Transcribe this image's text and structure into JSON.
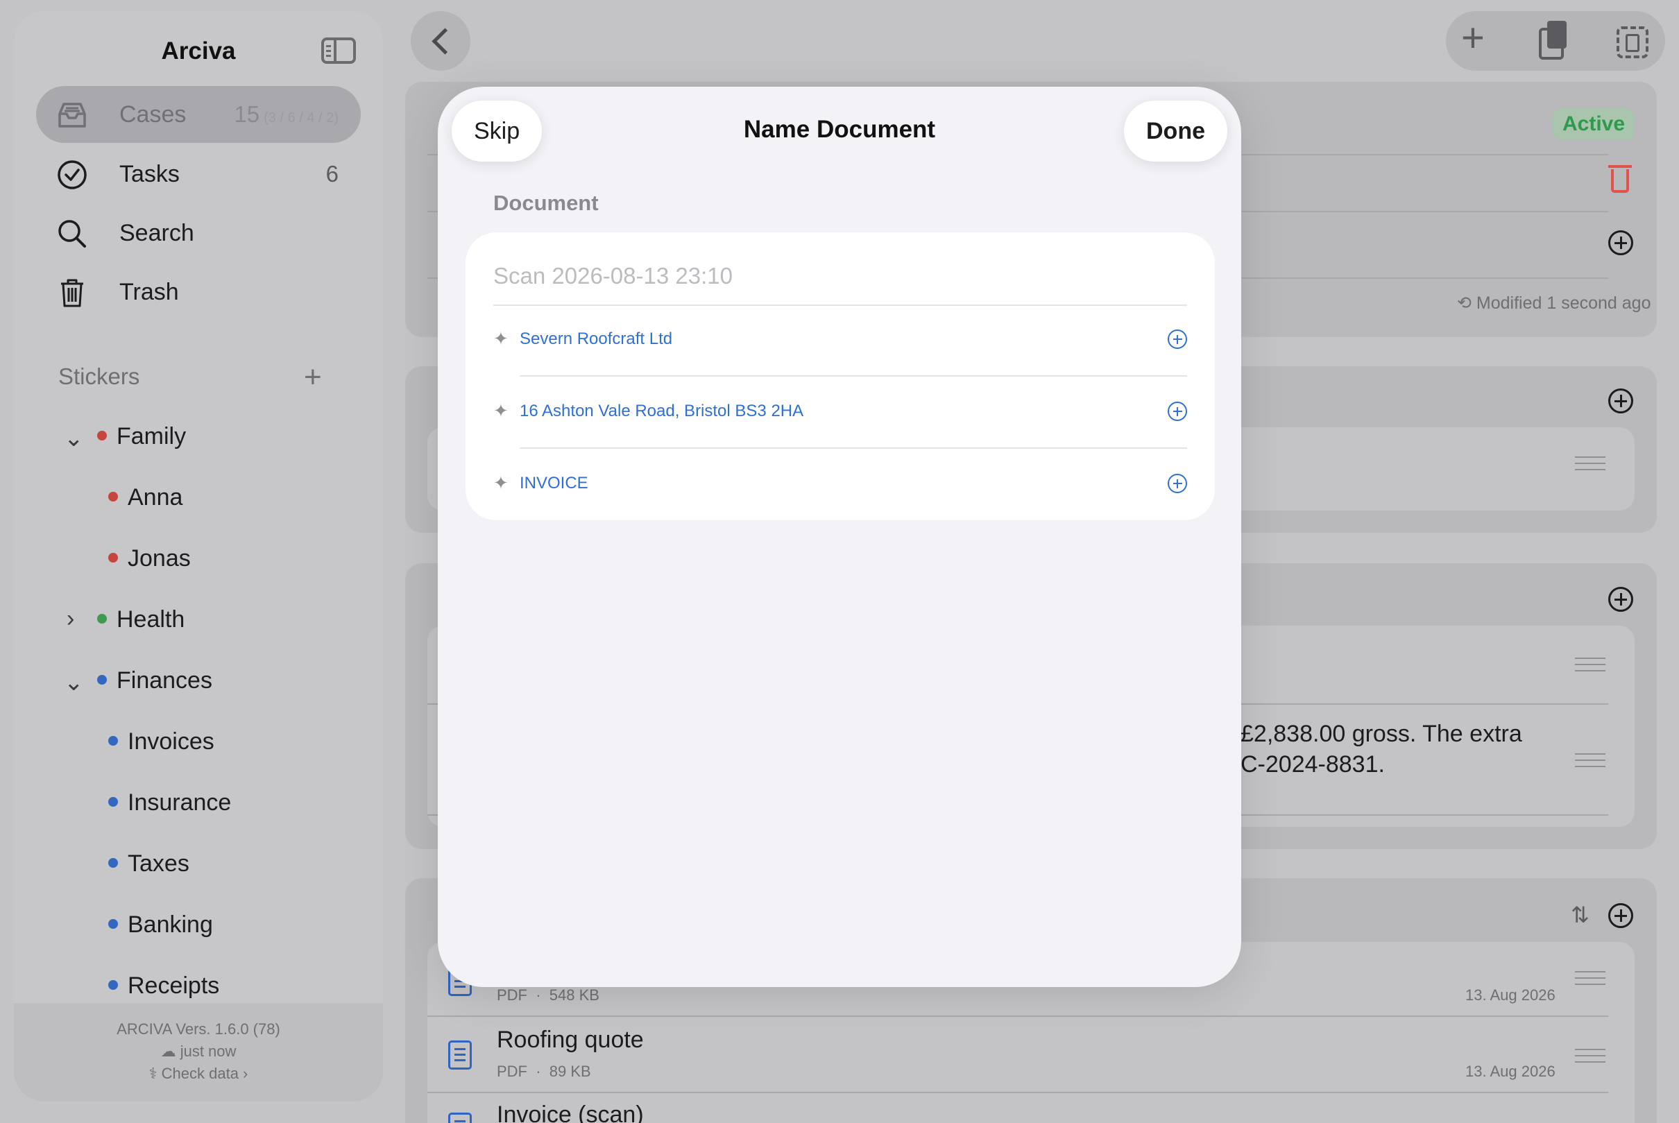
{
  "sidebar": {
    "title": "Arciva",
    "nav": [
      {
        "label": "Cases",
        "count": "15",
        "sub": "(3 / 6 / 4 / 2)"
      },
      {
        "label": "Tasks",
        "count": "6"
      },
      {
        "label": "Search"
      },
      {
        "label": "Trash"
      }
    ],
    "stickers_header": "Stickers",
    "stickers": [
      {
        "label": "Family",
        "color": "#c8453d",
        "level": 0,
        "expanded": true
      },
      {
        "label": "Anna",
        "color": "#c8453d",
        "level": 1
      },
      {
        "label": "Jonas",
        "color": "#c8453d",
        "level": 1
      },
      {
        "label": "Health",
        "color": "#3f9a4f",
        "level": 0,
        "expanded": false
      },
      {
        "label": "Finances",
        "color": "#3567c0",
        "level": 0,
        "expanded": true
      },
      {
        "label": "Invoices",
        "color": "#3567c0",
        "level": 1
      },
      {
        "label": "Insurance",
        "color": "#3567c0",
        "level": 1
      },
      {
        "label": "Taxes",
        "color": "#3567c0",
        "level": 1
      },
      {
        "label": "Banking",
        "color": "#3567c0",
        "level": 1
      },
      {
        "label": "Receipts",
        "color": "#3567c0",
        "level": 1
      }
    ],
    "footer": {
      "version": "ARCIVA  Vers. 1.6.0 (78)",
      "sync": "just now",
      "check": "Check data"
    }
  },
  "background": {
    "status": "Active",
    "modified": "Modified 1 second ago",
    "note_line1": "£2,838.00 gross. The extra",
    "note_line2": "C-2024-8831.",
    "documents": [
      {
        "title": "",
        "type": "PDF",
        "size": "548 KB",
        "date": "13. Aug 2026"
      },
      {
        "title": "Roofing quote",
        "type": "PDF",
        "size": "89 KB",
        "date": "13. Aug 2026"
      },
      {
        "title": "Invoice (scan)",
        "type": "",
        "size": "",
        "date": ""
      }
    ]
  },
  "modal": {
    "title": "Name Document",
    "skip": "Skip",
    "done": "Done",
    "section": "Document",
    "placeholder": "Scan 2026-08-13 23:10",
    "suggestions": [
      "Severn Roofcraft Ltd",
      "16 Ashton Vale Road, Bristol BS3 2HA",
      "INVOICE"
    ]
  },
  "colors": {
    "accent": "#2f6fd8",
    "active_green": "#2e9a4d",
    "danger": "#e0524c"
  }
}
